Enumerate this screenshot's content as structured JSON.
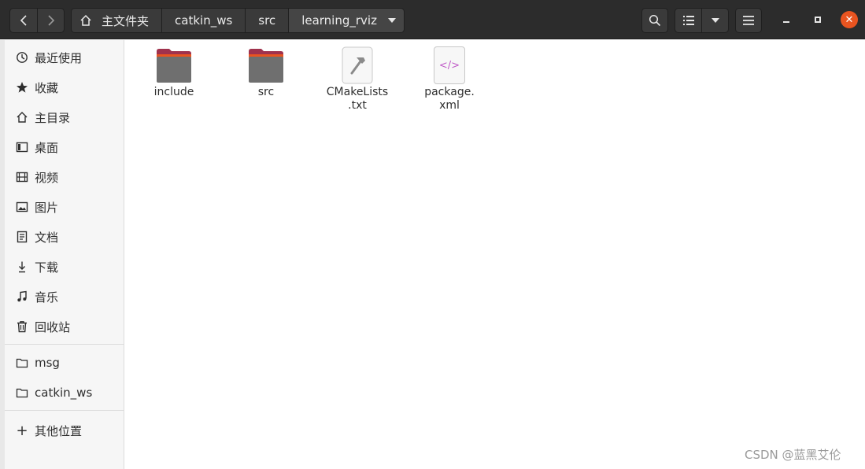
{
  "header": {
    "back_icon": "chevron-left-icon",
    "forward_icon": "chevron-right-icon",
    "breadcrumbs": [
      "主文件夹",
      "catkin_ws",
      "src",
      "learning_rviz"
    ],
    "close_glyph": "✕"
  },
  "sidebar": {
    "items": [
      {
        "label": "最近使用",
        "icon": "clock-icon"
      },
      {
        "label": "收藏",
        "icon": "star-icon"
      },
      {
        "label": "主目录",
        "icon": "home-icon"
      },
      {
        "label": "桌面",
        "icon": "desktop-icon"
      },
      {
        "label": "视频",
        "icon": "film-icon"
      },
      {
        "label": "图片",
        "icon": "image-icon"
      },
      {
        "label": "文档",
        "icon": "document-icon"
      },
      {
        "label": "下载",
        "icon": "download-icon"
      },
      {
        "label": "音乐",
        "icon": "music-icon"
      },
      {
        "label": "回收站",
        "icon": "trash-icon"
      }
    ],
    "bookmarks": [
      {
        "label": "msg",
        "icon": "folder-icon"
      },
      {
        "label": "catkin_ws",
        "icon": "folder-icon"
      }
    ],
    "other": {
      "label": "其他位置",
      "icon": "plus-icon",
      "glyph": "+"
    }
  },
  "files": [
    {
      "name": "include",
      "type": "folder-icon"
    },
    {
      "name": "src",
      "type": "folder-icon"
    },
    {
      "name": "CMakeLists\n.txt",
      "type": "cmake-file-icon"
    },
    {
      "name": "package.\nxml",
      "type": "xml-file-icon",
      "glyph": "</>"
    }
  ],
  "watermark": "CSDN @蓝黑艾伦",
  "colors": {
    "header_bg": "#2c2c2c",
    "folder_body": "#6f6f6f",
    "folder_tab": "#a0324d",
    "folder_accent": "#e95420",
    "close": "#e95420"
  }
}
